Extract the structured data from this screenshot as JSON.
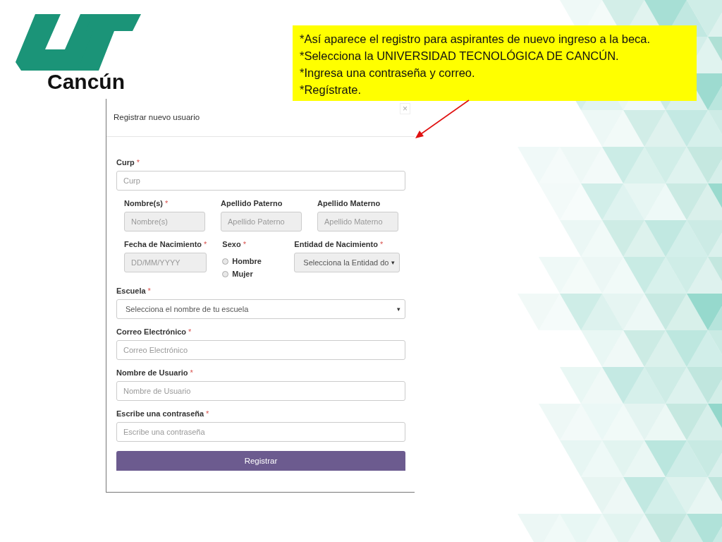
{
  "logo": {
    "text": "Cancún"
  },
  "note": {
    "lines": [
      "*Así aparece el registro para aspirantes de nuevo ingreso a la beca.",
      "*Selecciona la UNIVERSIDAD TECNOLÓGICA DE CANCÚN.",
      "*Ingresa una contraseña y correo.",
      "*Regístrate."
    ]
  },
  "form": {
    "title": "Registrar nuevo usuario",
    "close": "×",
    "rows": [
      {
        "fields": [
          {
            "kind": "input",
            "label": "Curp",
            "required_mark": "*",
            "placeholder": "Curp",
            "disabled": false
          }
        ]
      },
      {
        "fields": [
          {
            "kind": "input",
            "label": "Nombre(s)",
            "required_mark": "*",
            "placeholder": "Nombre(s)",
            "disabled": true
          },
          {
            "kind": "input",
            "label": "Apellido Paterno",
            "placeholder": "Apellido Paterno",
            "disabled": true
          },
          {
            "kind": "input",
            "label": "Apellido Materno",
            "placeholder": "Apellido Materno",
            "disabled": true
          }
        ]
      },
      {
        "fields": [
          {
            "kind": "input",
            "label": "Fecha de Nacimiento",
            "required_mark": "*",
            "placeholder": "DD/MM/YYYY",
            "disabled": true
          },
          {
            "kind": "radio",
            "label": "Sexo",
            "required_mark": "*",
            "options": [
              {
                "label": "Hombre",
                "selected": false
              },
              {
                "label": "Mujer",
                "selected": false
              }
            ]
          },
          {
            "kind": "select",
            "label": "Entidad de Nacimiento",
            "required_mark": "*",
            "value": "Selecciona la Entidad do",
            "caret": "▾",
            "disabled": true
          }
        ]
      },
      {
        "fields": [
          {
            "kind": "select",
            "label": "Escuela",
            "required_mark": "*",
            "value": "Selecciona el nombre de tu escuela",
            "caret": "▾",
            "disabled": false
          }
        ]
      },
      {
        "fields": [
          {
            "kind": "input",
            "label": "Correo Electrónico",
            "required_mark": "*",
            "placeholder": "Correo Electrónico",
            "disabled": false
          }
        ]
      },
      {
        "fields": [
          {
            "kind": "input",
            "label": "Nombre de Usuario",
            "required_mark": "*",
            "placeholder": "Nombre de Usuario",
            "disabled": false
          }
        ]
      },
      {
        "fields": [
          {
            "kind": "input",
            "label": "Escribe una contraseña",
            "required_mark": "*",
            "placeholder": "Escribe una contraseña",
            "disabled": false
          }
        ]
      }
    ],
    "submit": "Registrar"
  }
}
